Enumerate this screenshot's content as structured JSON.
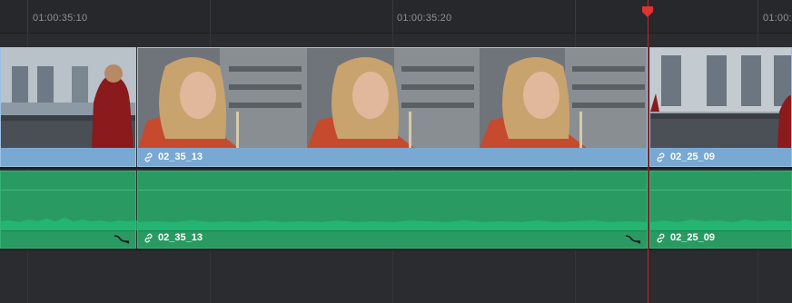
{
  "ruler": {
    "timecodes": [
      "01:00:35:10",
      "01:00:35:20",
      "01:00:3"
    ]
  },
  "video_track": {
    "clips": [
      {
        "name": ""
      },
      {
        "name": "02_35_13"
      },
      {
        "name": "02_25_09"
      }
    ]
  },
  "audio_track": {
    "clips": [
      {
        "name": ""
      },
      {
        "name": "02_35_13"
      },
      {
        "name": "02_25_09"
      }
    ]
  },
  "colors": {
    "video_clip": "#79a8d2",
    "audio_clip": "#2a9a63",
    "playhead": "#c0262b"
  },
  "icons": {
    "link": "link-icon",
    "fade": "fade-handle-icon",
    "playhead": "playhead-marker-icon"
  }
}
